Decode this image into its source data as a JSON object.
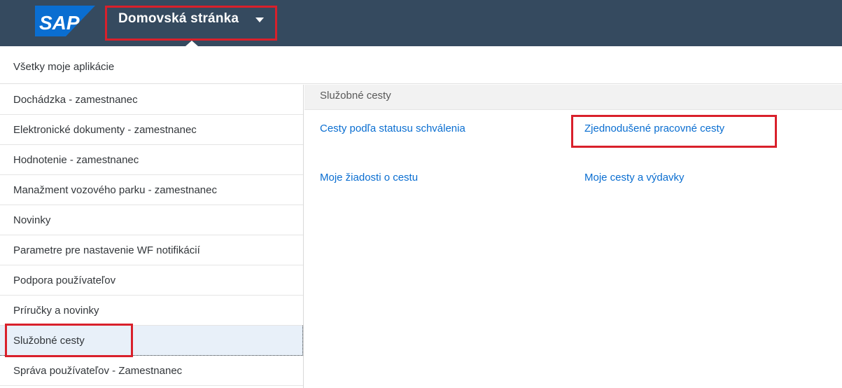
{
  "shell": {
    "logo_text": "SAP",
    "title": "Domovská stránka",
    "colors": {
      "shell_bg": "#354a5f",
      "logo_blue": "#0a6ed1",
      "highlight_red": "#d9202b",
      "link": "#0a6ed1"
    }
  },
  "header": {
    "label": "Všetky moje aplikácie"
  },
  "sidebar": {
    "selected_index": 8,
    "items": [
      {
        "label": "Dochádzka - zamestnanec"
      },
      {
        "label": "Elektronické dokumenty - zamestnanec"
      },
      {
        "label": "Hodnotenie - zamestnanec"
      },
      {
        "label": "Manažment vozového parku - zamestnanec"
      },
      {
        "label": "Novinky"
      },
      {
        "label": "Parametre pre nastavenie WF notifikácií"
      },
      {
        "label": "Podpora používateľov"
      },
      {
        "label": "Príručky a novinky"
      },
      {
        "label": "Služobné cesty"
      },
      {
        "label": "Správa používateľov - Zamestnanec"
      }
    ]
  },
  "main": {
    "section_title": "Služobné cesty",
    "links": [
      {
        "label": "Cesty podľa statusu schválenia"
      },
      {
        "label": "Zjednodušené pracovné cesty"
      },
      {
        "label": "Moje žiadosti o cestu"
      },
      {
        "label": "Moje cesty a výdavky"
      }
    ]
  }
}
